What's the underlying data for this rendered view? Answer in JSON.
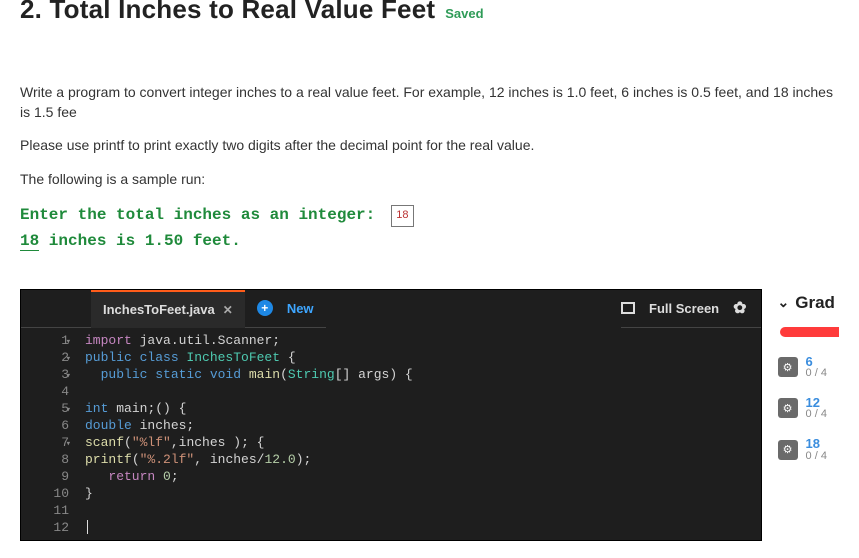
{
  "header": {
    "title": "2. Total Inches to Real Value Feet",
    "saved_label": "Saved"
  },
  "description": {
    "p1": "Write a program to convert integer inches to a real value feet. For example, 12 inches is 1.0 feet,  6 inches is 0.5 feet, and 18 inches is 1.5 fee",
    "p2": "Please use printf to print exactly two digits after the decimal point for the real value.",
    "p3": "The following is a sample run:"
  },
  "sample": {
    "prompt": "Enter the total inches as an integer: ",
    "input_value": "18",
    "result_prefix_underlined": "18",
    "result_rest": " inches is 1.50 feet."
  },
  "editor": {
    "active_tab": "InchesToFeet.java",
    "new_tab_label": "New",
    "fullscreen_label": "Full Screen",
    "lines": [
      {
        "n": "1",
        "fold": true,
        "tokens": [
          [
            "kw-purple",
            "import "
          ],
          [
            "plain",
            "java"
          ],
          [
            "plain",
            "."
          ],
          [
            "plain",
            "util"
          ],
          [
            "plain",
            "."
          ],
          [
            "plain",
            "Scanner"
          ],
          [
            "plain",
            ";"
          ]
        ]
      },
      {
        "n": "2",
        "fold": true,
        "tokens": [
          [
            "kw-blue",
            "public "
          ],
          [
            "kw-blue",
            "class "
          ],
          [
            "type-teal",
            "InchesToFeet"
          ],
          [
            "plain",
            " {"
          ]
        ]
      },
      {
        "n": "3",
        "fold": true,
        "indent": "  ",
        "tokens": [
          [
            "kw-blue",
            "public "
          ],
          [
            "kw-blue",
            "static "
          ],
          [
            "kw-blue",
            "void "
          ],
          [
            "id-yl",
            "main"
          ],
          [
            "plain",
            "("
          ],
          [
            "type-teal",
            "String"
          ],
          [
            "plain",
            "[] "
          ],
          [
            "plain",
            "args"
          ],
          [
            "plain",
            ") {"
          ]
        ]
      },
      {
        "n": "4",
        "tokens": []
      },
      {
        "n": "5",
        "fold": true,
        "tokens": [
          [
            "kw-blue",
            "int "
          ],
          [
            "plain",
            "main"
          ],
          [
            "plain",
            ";"
          ],
          [
            "plain",
            "() {"
          ]
        ]
      },
      {
        "n": "6",
        "tokens": [
          [
            "kw-blue",
            "double "
          ],
          [
            "plain",
            "inches"
          ],
          [
            "plain",
            ";"
          ]
        ]
      },
      {
        "n": "7",
        "fold": true,
        "tokens": [
          [
            "id-yl",
            "scanf"
          ],
          [
            "plain",
            "("
          ],
          [
            "str",
            "\"%lf\""
          ],
          [
            "plain",
            ","
          ],
          [
            "plain",
            "inches "
          ],
          [
            "plain",
            "); {"
          ]
        ]
      },
      {
        "n": "8",
        "tokens": [
          [
            "id-yl",
            "printf"
          ],
          [
            "plain",
            "("
          ],
          [
            "str",
            "\"%.2lf\""
          ],
          [
            "plain",
            ", "
          ],
          [
            "plain",
            "inches"
          ],
          [
            "plain",
            "/"
          ],
          [
            "num",
            "12.0"
          ],
          [
            "plain",
            ");"
          ]
        ]
      },
      {
        "n": "9",
        "indent": "   ",
        "tokens": [
          [
            "kw-purple",
            "return "
          ],
          [
            "num",
            "0"
          ],
          [
            "plain",
            ";"
          ]
        ]
      },
      {
        "n": "10",
        "tokens": [
          [
            "plain",
            "}"
          ]
        ]
      },
      {
        "n": "11",
        "tokens": []
      },
      {
        "n": "12",
        "cursor": true,
        "tokens": []
      }
    ]
  },
  "grading": {
    "heading": "Grad",
    "items": [
      {
        "label": "6",
        "score": "0 / 4"
      },
      {
        "label": "12",
        "score": "0 / 4"
      },
      {
        "label": "18",
        "score": "0 / 4"
      }
    ]
  }
}
